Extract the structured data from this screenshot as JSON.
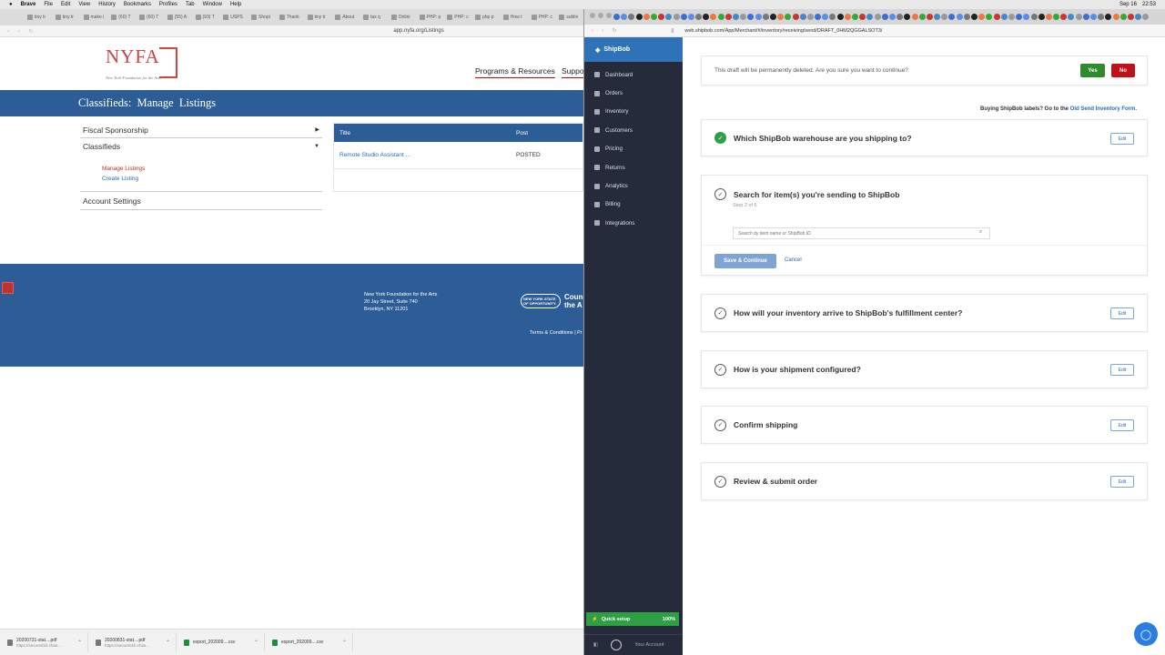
{
  "menubar": {
    "app": "Brave",
    "items": [
      "File",
      "Edit",
      "View",
      "History",
      "Bookmarks",
      "Profiles",
      "Tab",
      "Window",
      "Help"
    ],
    "date": "Sep 16",
    "time": "22:53"
  },
  "left_browser": {
    "tabs": [
      "tiny tr",
      "tiny tr",
      "make i",
      "(60) T",
      "(60) T",
      "(55) A",
      "(93) T",
      "USPS",
      "Shopi",
      "Thank",
      "tiny tr",
      "About",
      "tax q",
      "Onlini",
      "PHP: p",
      "PHP: c",
      "php p",
      "How t",
      "PHP: c",
      "sublin"
    ],
    "url": "app.nyfa.org/Listings"
  },
  "nyfa": {
    "logo_text": "NYFA",
    "logo_tagline": "New York Foundation for the Arts",
    "nav": [
      "Programs & Resources",
      "Suppo"
    ],
    "banner_title": "Classifieds:",
    "banner_subtitle": "Manage Listings",
    "sidenav": {
      "fiscal": "Fiscal Sponsorship",
      "classifieds": "Classifieds",
      "manage": "Manage Listings",
      "create": "Create Listing",
      "account": "Account Settings"
    },
    "table": {
      "headers": [
        "Title",
        "Post"
      ],
      "rows": [
        [
          "Remote Studio Assistant ...",
          "POSTED"
        ]
      ]
    },
    "footer": {
      "address": [
        "New York Foundation for the Arts",
        "20 Jay Street, Suite 740",
        "Brooklyn, NY 11201"
      ],
      "council_small": "NEW YORK STATE OF OPPORTUNITY.",
      "council": "Counc the A",
      "terms": "Terms & Conditions | Pr"
    }
  },
  "downloads": [
    {
      "name": "20200731-stat....pdf",
      "url": "https://secure01b.chas..."
    },
    {
      "name": "20200831-stat....pdf",
      "url": "https://secure01b.chas..."
    },
    {
      "name": "export_202009....csv",
      "url": ""
    },
    {
      "name": "export_202009....csv",
      "url": ""
    }
  ],
  "right_browser": {
    "url": "web.shipbob.com/App/Merchant/#/inventory/receiving/send/DRAFT_0HM2QGGALSOT3/"
  },
  "shipbob": {
    "brand": "ShipBob",
    "nav": [
      "Dashboard",
      "Orders",
      "Inventory",
      "Customers",
      "Pricing",
      "Returns",
      "Analytics",
      "Billing",
      "Integrations"
    ],
    "quick_setup": "Quick setup",
    "quick_pct": "100%",
    "account": "Your Account",
    "confirm_text": "This draft will be permanently deleted. Are you sure you want to continue?",
    "yes": "Yes",
    "no": "No",
    "labels_note": "Buying ShipBob labels? Go to the",
    "labels_link": "Old Send Inventory Form.",
    "steps": [
      "Which ShipBob warehouse are you shipping to?",
      "Search for item(s) you're sending to ShipBob",
      "How will your inventory arrive to ShipBob's fulfillment center?",
      "How is your shipment configured?",
      "Confirm shipping",
      "Review & submit order"
    ],
    "step_progress": "Step 2 of 6",
    "search_placeholder": "Search by item name or ShipBob ID",
    "save": "Save & Continue",
    "cancel": "Cancel",
    "edit": "Edit",
    "colors": {
      "accent": "#2f72b8",
      "sidebar": "#252b3b",
      "success": "#2ea043",
      "danger": "#c0101a"
    }
  }
}
